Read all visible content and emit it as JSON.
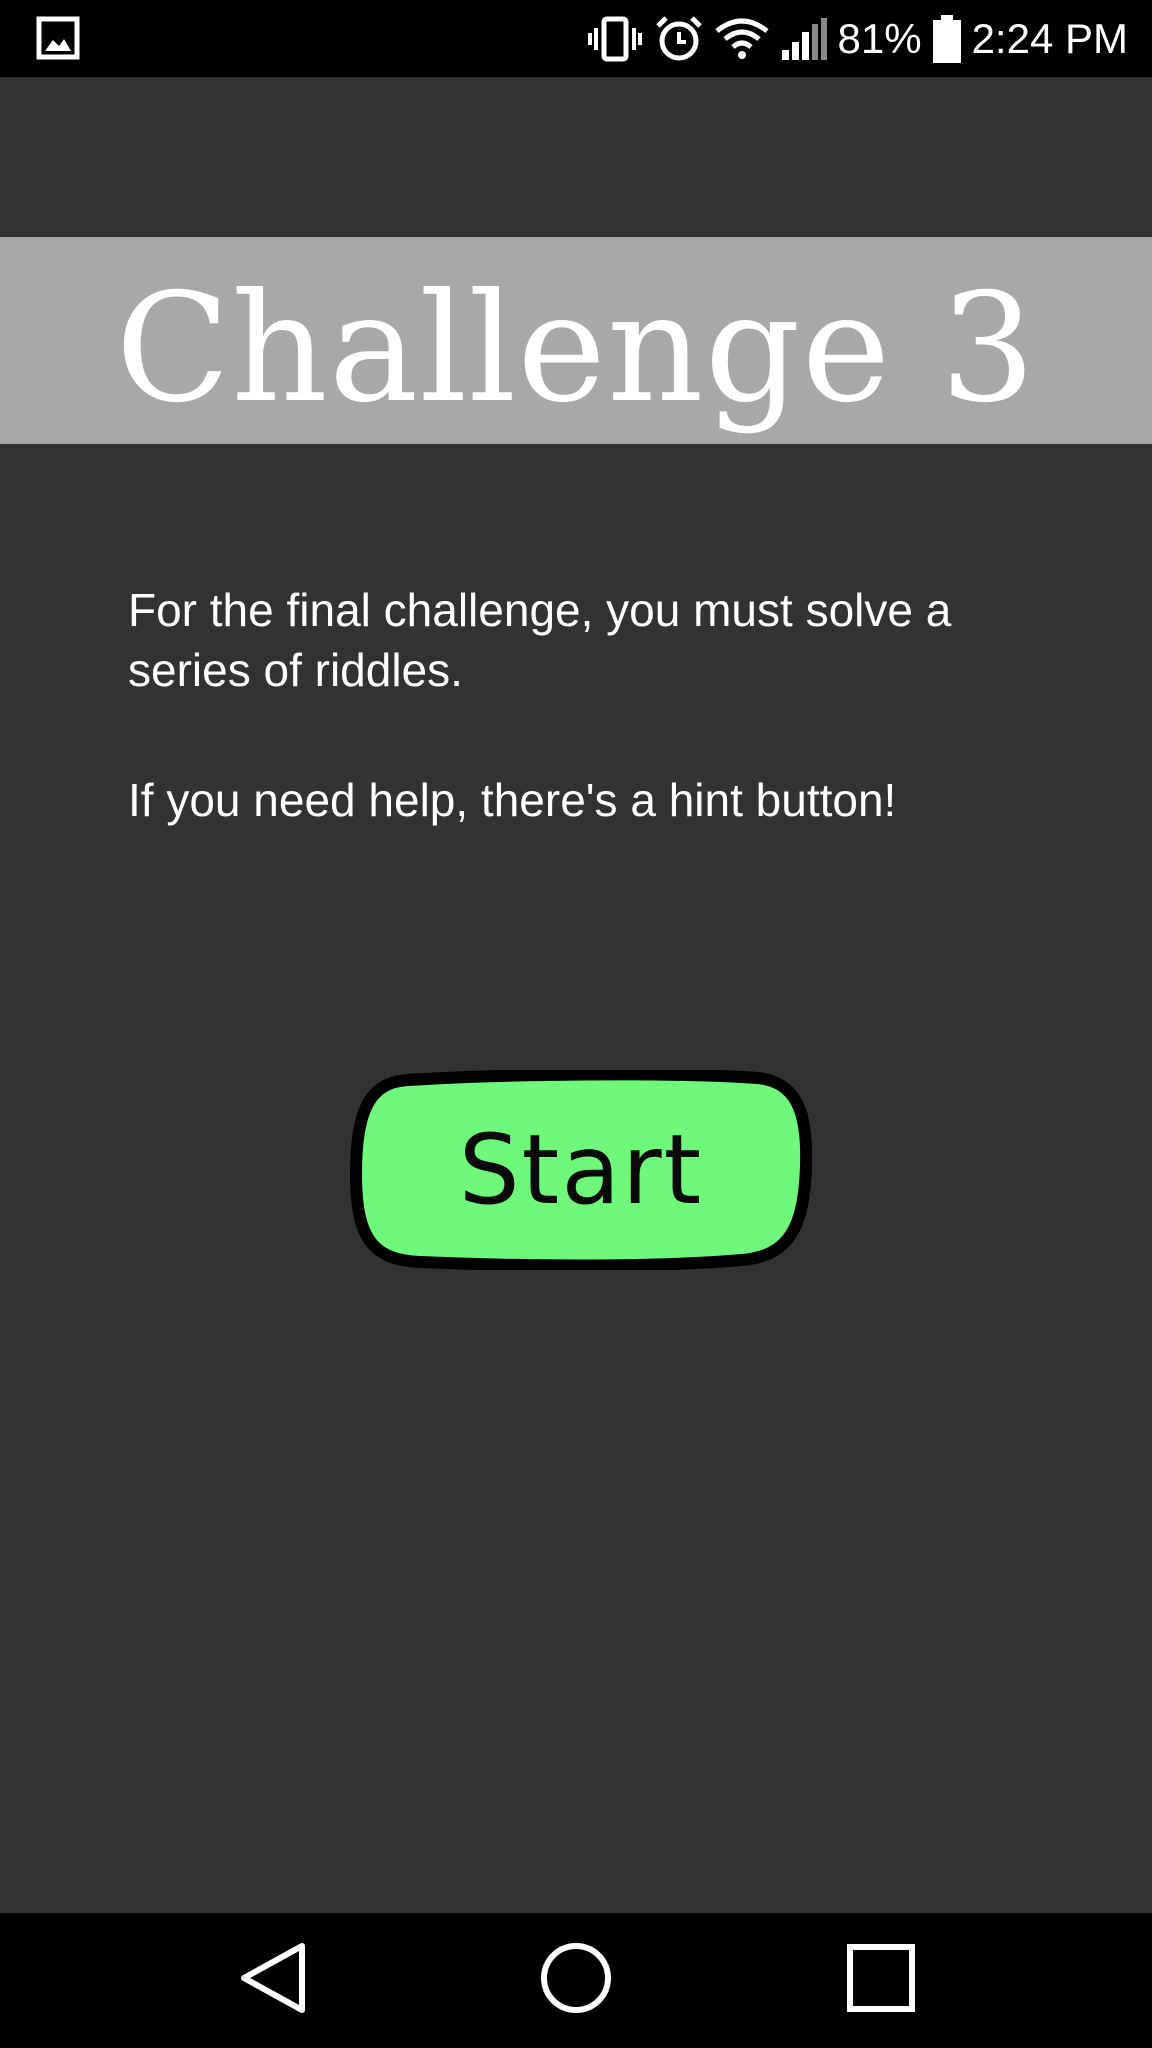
{
  "status_bar": {
    "battery_percent": "81%",
    "time": "2:24 PM",
    "icons": [
      "image-notification-icon",
      "vibrate-icon",
      "alarm-icon",
      "wifi-icon",
      "signal-icon",
      "battery-icon"
    ]
  },
  "screen": {
    "title": "Challenge 3",
    "paragraphs": [
      "For the final challenge, you must solve a series of riddles.",
      "If you need help, there's a hint button!"
    ],
    "start_button_label": "Start"
  },
  "navigation": {
    "buttons": [
      "back-icon",
      "home-icon",
      "recents-icon"
    ]
  },
  "colors": {
    "background": "#333231",
    "title_banner": "#a8a8a8",
    "start_button_fill": "#6ef97a",
    "start_button_outline": "#000000",
    "system_bars": "#000000"
  }
}
